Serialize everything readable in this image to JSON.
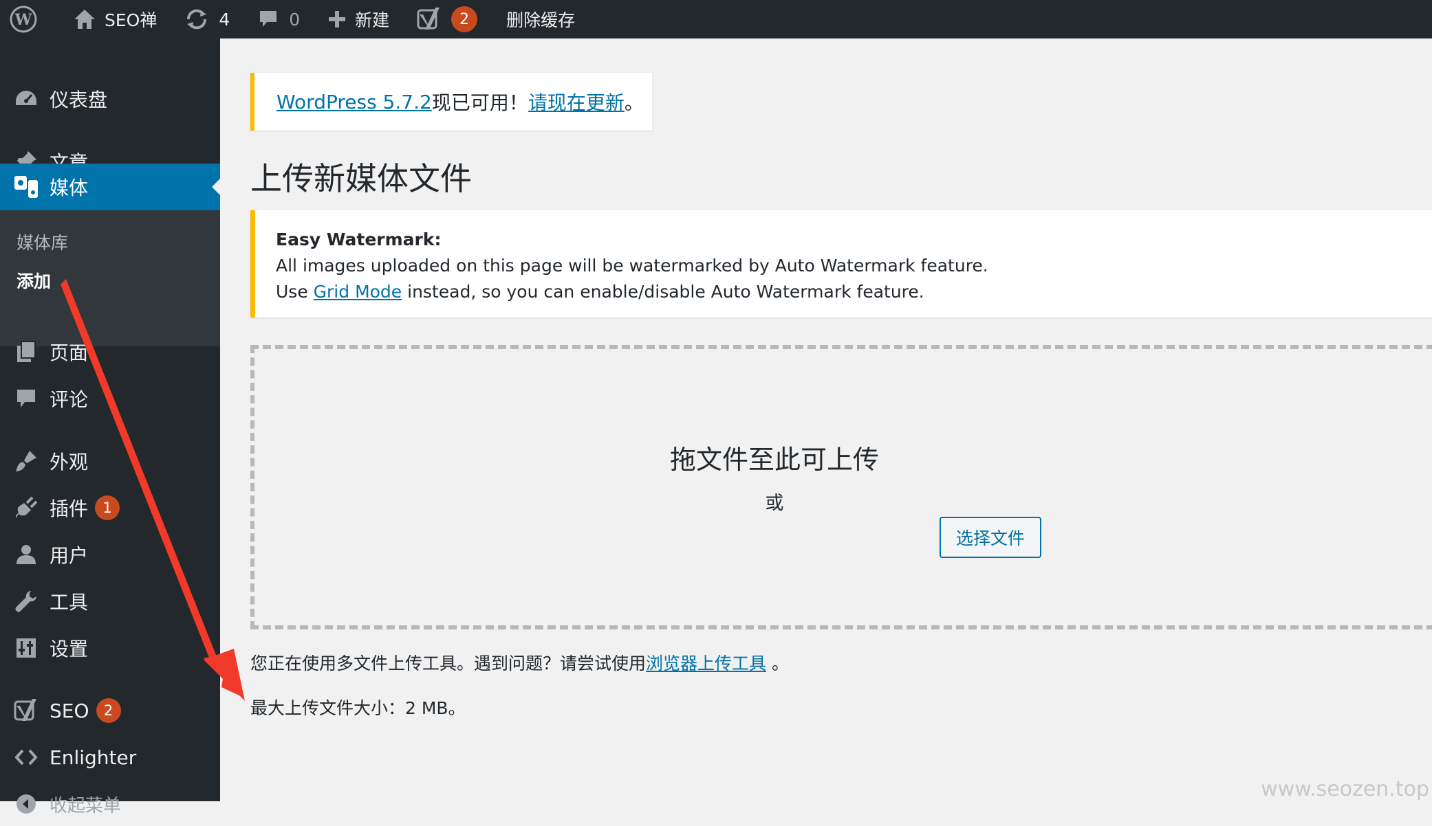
{
  "adminbar": {
    "site_name": "SEO禅",
    "updates_count": "4",
    "comments_count": "0",
    "new_label": "新建",
    "yoast_badge": "2",
    "clear_cache_label": "删除缓存"
  },
  "sidebar": {
    "items": [
      {
        "label": "仪表盘",
        "icon": "dashboard-icon"
      },
      {
        "label": "文章",
        "icon": "pin-icon"
      },
      {
        "label": "媒体",
        "icon": "media-icon"
      },
      {
        "label": "页面",
        "icon": "page-icon"
      },
      {
        "label": "评论",
        "icon": "comment-icon"
      },
      {
        "label": "外观",
        "icon": "brush-icon"
      },
      {
        "label": "插件",
        "icon": "plugin-icon",
        "badge": "1"
      },
      {
        "label": "用户",
        "icon": "user-icon"
      },
      {
        "label": "工具",
        "icon": "wrench-icon"
      },
      {
        "label": "设置",
        "icon": "settings-icon"
      },
      {
        "label": "SEO",
        "icon": "yoast-icon",
        "badge": "2"
      },
      {
        "label": "Enlighter",
        "icon": "code-icon"
      },
      {
        "label": "收起菜单",
        "icon": "collapse-icon"
      }
    ],
    "submenu": {
      "library": "媒体库",
      "add_new": "添加"
    }
  },
  "notice_update": {
    "link1": "WordPress 5.7.2",
    "text": "现已可用！",
    "link2": "请现在更新",
    "end": "。"
  },
  "page_title": "上传新媒体文件",
  "notice_watermark": {
    "title": "Easy Watermark:",
    "line1": "All images uploaded on this page will be watermarked by Auto Watermark feature.",
    "line2_pre": "Use ",
    "line2_link": "Grid Mode",
    "line2_post": " instead, so you can enable/disable Auto Watermark feature."
  },
  "dropzone": {
    "info": "拖文件至此可上传",
    "or": "或",
    "select_button": "选择文件"
  },
  "uploader_note": {
    "text": "您正在使用多文件上传工具。遇到问题？请尝试使用",
    "link": "浏览器上传工具",
    "end": " 。"
  },
  "max_size": "最大上传文件大小：2 MB。",
  "site_watermark": "www.seozen.top",
  "colors": {
    "adminbar_bg": "#23282d",
    "accent": "#0073aa",
    "notice_warning": "#ffb900",
    "badge": "#ca4a1f",
    "annotation_arrow": "#f23a2a"
  }
}
